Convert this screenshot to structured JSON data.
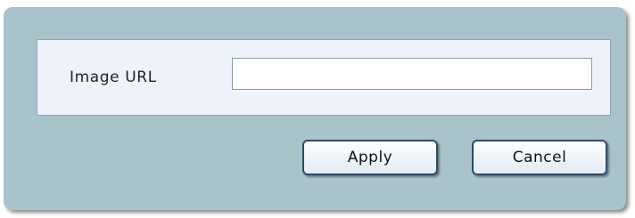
{
  "dialog": {
    "field_label": "Image URL",
    "url_value": "",
    "url_placeholder": "",
    "apply_label": "Apply",
    "cancel_label": "Cancel"
  },
  "colors": {
    "dialog_background": "#a9c3ca",
    "panel_background": "#eef3fb",
    "button_border": "#2f4a66"
  }
}
